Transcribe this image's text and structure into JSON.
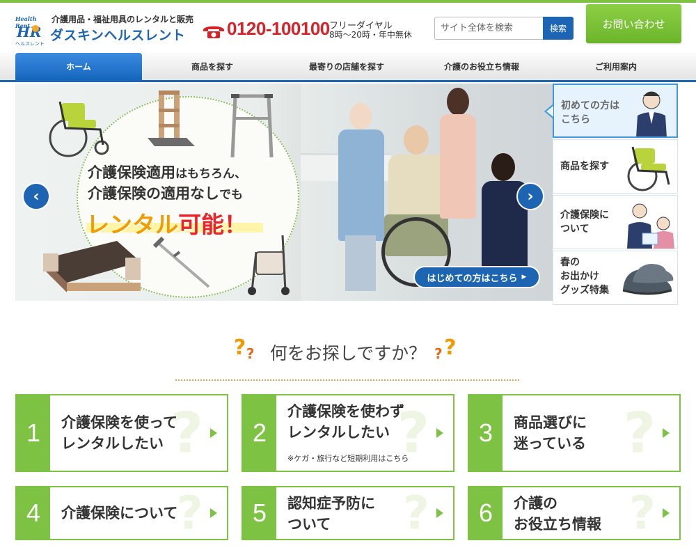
{
  "header": {
    "logo_text": "Health Rent",
    "logo_sub": "ヘルスレント",
    "tagline": "介護用品・福祉用具のレンタルと販売",
    "brand": "ダスキンヘルスレント",
    "phone": "0120-100100",
    "phone_label": "フリーダイヤル",
    "phone_hours": "8時～20時・年中無休",
    "search_placeholder": "サイト全体を検索",
    "search_button": "検索",
    "contact_button": "お問い合わせ"
  },
  "nav": {
    "items": [
      {
        "label": "ホーム",
        "active": true
      },
      {
        "label": "商品を探す"
      },
      {
        "label": "最寄りの店舗を探す"
      },
      {
        "label": "介護のお役立ち情報"
      },
      {
        "label": "ご利用案内"
      }
    ]
  },
  "hero": {
    "line1_a": "介護保険適用",
    "line1_b": "はもちろん、",
    "line2_a": "介護保険の適用なし",
    "line2_b": "でも",
    "line3_a": "レンタル",
    "line3_b": "可能！",
    "cta": "はじめての方はこちら",
    "prev_arrow": "‹",
    "next_arrow": "›"
  },
  "sidebar": {
    "items": [
      {
        "line1": "初めての方は",
        "line2": "こちら"
      },
      {
        "line1": "商品を探す",
        "line2": ""
      },
      {
        "line1": "介護保険に",
        "line2": "ついて"
      },
      {
        "line1": "春の",
        "line2": "お出かけ",
        "line3": "グッズ特集"
      }
    ]
  },
  "section": {
    "title": "何をお探しですか？"
  },
  "cards": [
    {
      "num": "1",
      "line1": "介護保険を使って",
      "line2": "レンタルしたい",
      "note": ""
    },
    {
      "num": "2",
      "line1": "介護保険を使わず",
      "line2": "レンタルしたい",
      "note": "※ケガ・旅行など短期利用はこちら"
    },
    {
      "num": "3",
      "line1": "商品選びに",
      "line2": "迷っている",
      "note": ""
    },
    {
      "num": "4",
      "line1": "介護保険について",
      "line2": "",
      "note": ""
    },
    {
      "num": "5",
      "line1": "認知症予防に",
      "line2": "ついて",
      "note": ""
    },
    {
      "num": "6",
      "line1": "介護の",
      "line2": "お役立ち情報",
      "note": ""
    }
  ],
  "colors": {
    "brand_blue": "#1d64b3",
    "accent_green": "#7dc242",
    "phone_red": "#d5232a",
    "hero_orange": "#f29b00"
  }
}
